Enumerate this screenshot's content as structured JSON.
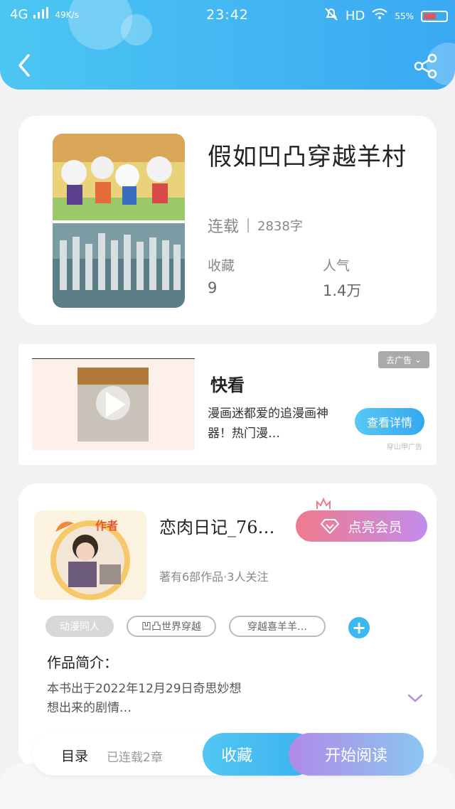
{
  "status_bar": {
    "network": "4G",
    "speed": "49K/s",
    "time": "23:42",
    "hd": "HD",
    "battery": "55%",
    "battery_level": 0.55
  },
  "header": {
    "back_icon": "chevron-left-icon",
    "share_icon": "share-icon"
  },
  "book": {
    "title": "假如凹凸穿越羊村",
    "status": "连载",
    "word_count": "2838字",
    "favorites_label": "收藏",
    "favorites_value": "9",
    "popularity_label": "人气",
    "popularity_value": "1.4万"
  },
  "ad": {
    "title": "快看",
    "description": "漫画迷都爱的追漫画神器！热门漫…",
    "close_label": "去广告",
    "detail_button": "查看详情",
    "source": "穿山甲广告"
  },
  "author": {
    "badge": "作者",
    "name": "恋肉日记_76…",
    "vip_button": "点亮会员",
    "stats": "著有6部作品·3人关注",
    "tags": [
      "动漫同人",
      "凹凸世界穿越",
      "穿越喜羊羊…"
    ],
    "add_tag": "+",
    "intro_title": "作品简介：",
    "intro_body": "本书出于2022年12月29日奇思妙想想出来的剧情…"
  },
  "bottom_bar": {
    "toc_label": "目录",
    "toc_count": "已连载2章",
    "favorite_button": "收藏",
    "read_button": "开始阅读"
  },
  "colors": {
    "header_start": "#4cc6f2",
    "header_end": "#3aa9f2",
    "accent_blue": "#3cb7f2",
    "vip_pink": "#f07a8c",
    "vip_purple": "#c28cec"
  }
}
